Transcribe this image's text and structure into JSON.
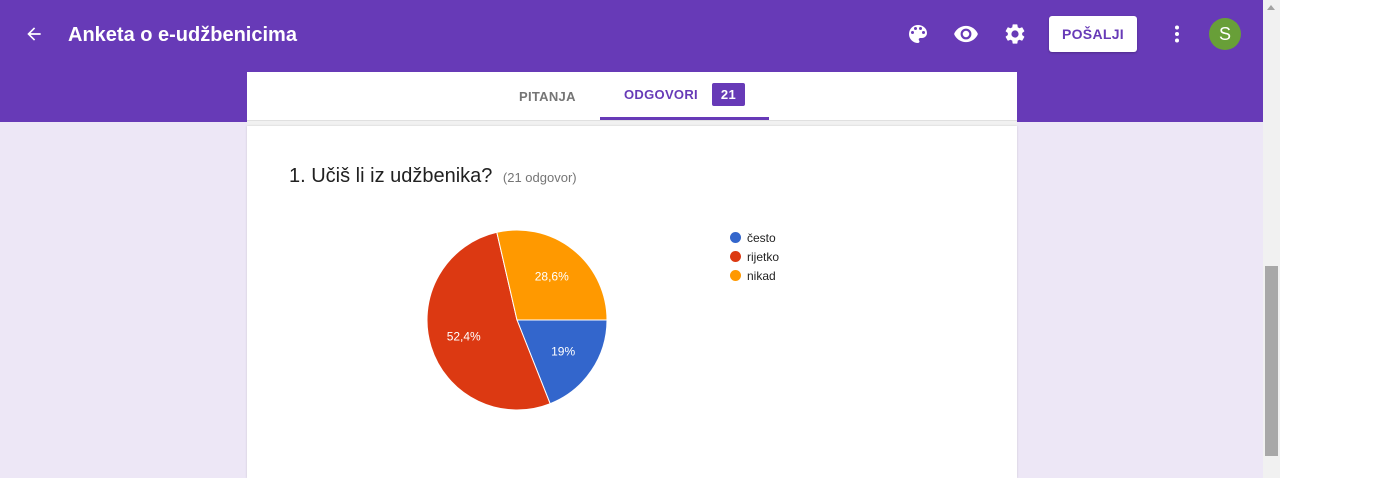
{
  "header": {
    "title": "Anketa o e-udžbenicima",
    "send_label": "POŠALJI",
    "avatar_letter": "S",
    "icons": [
      "arrow-back-icon",
      "palette-icon",
      "eye-icon",
      "gear-icon",
      "more-vert-icon"
    ],
    "colors": {
      "primary": "#673ab7",
      "avatar": "#689f38"
    }
  },
  "tabs": {
    "questions_label": "PITANJA",
    "responses_label": "ODGOVORI",
    "responses_count": "21"
  },
  "question": {
    "title": "1. Učiš li iz udžbenika?",
    "count": "(21 odgovor)"
  },
  "chart_data": {
    "type": "pie",
    "categories": [
      "često",
      "rijetko",
      "nikad"
    ],
    "values": [
      19.0,
      52.4,
      28.6
    ],
    "labels": [
      "19%",
      "52,4%",
      "28,6%"
    ],
    "colors": [
      "#3366cc",
      "#dc3912",
      "#ff9900"
    ],
    "legend_position": "right"
  }
}
